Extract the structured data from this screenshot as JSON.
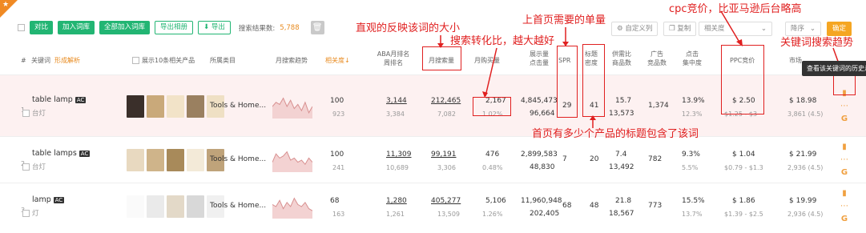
{
  "toolbar": {
    "btn_export_cut": "对比",
    "btn_add_root": "加入词库",
    "btn_add_all": "全部加入词库",
    "btn_export_img": "导出相册",
    "btn_export": "导出",
    "total_label": "搜索结果数:",
    "total_value": "5,788",
    "custom_cols": "自定义列",
    "copy": "复制",
    "sort_field": "相关度",
    "sort_order": "降序",
    "confirm": "确定"
  },
  "headers": {
    "idx": "#",
    "keyword": "关键词",
    "keyword_sub": "形成解析",
    "show_products": "展示10条相关产品",
    "category": "所属类目",
    "trend": "月搜索趋势",
    "relevance": "相关度",
    "aba_rank": "ABA月排名",
    "aba_rank2": "周排名",
    "monthly_search": "月搜索量",
    "monthly_purchase": "月购买量",
    "impressions": "展示量",
    "clicks": "点击量",
    "spr": "SPR",
    "title_density": "标题",
    "title_density2": "密度",
    "supply_demand": "供需比",
    "product_count": "商品数",
    "ad_products": "广告",
    "ad_products2": "竞品数",
    "click_concentration": "点击",
    "click_concentration2": "集中度",
    "ppc": "PPC竞价",
    "market": "市场"
  },
  "rows": [
    {
      "idx": "1",
      "keyword": "table lamp",
      "badge": "AC",
      "cn": "台灯",
      "category": "Tools & Home...",
      "relevance": "100",
      "relevance_sub": "923",
      "aba_rank": "3,144",
      "aba_week": "3,384",
      "monthly_search": "212,465",
      "monthly_search_sub": "7,082",
      "monthly_purchase": "2,167",
      "conversion": "1.02%",
      "impressions": "4,845,473",
      "clicks": "96,664",
      "spr": "29",
      "title_density": "41",
      "supply_demand": "15.7",
      "product_count": "13,573",
      "ad_products": "1,374",
      "click_conc": "13.9%",
      "click_conc_sub": "12.3%",
      "ppc": "$ 2.50",
      "ppc_range": "$1.25 - $3",
      "market": "$ 18.98",
      "market_sub": "3,861 (4.5)",
      "trend": [
        0.5,
        0.7,
        0.6,
        0.9,
        0.5,
        0.8,
        0.4,
        0.6,
        0.3,
        0.7,
        0.2,
        0.5
      ]
    },
    {
      "idx": "2",
      "keyword": "table lamps",
      "badge": "AC",
      "cn": "台灯",
      "category": "Tools & Home...",
      "relevance": "100",
      "relevance_sub": "241",
      "aba_rank": "11,309",
      "aba_week": "10,689",
      "monthly_search": "99,191",
      "monthly_search_sub": "3,306",
      "monthly_purchase": "476",
      "conversion": "0.48%",
      "impressions": "2,899,583",
      "clicks": "48,830",
      "spr": "7",
      "title_density": "20",
      "supply_demand": "7.4",
      "product_count": "13,492",
      "ad_products": "782",
      "click_conc": "9.3%",
      "click_conc_sub": "5.5%",
      "ppc": "$ 1.04",
      "ppc_range": "$0.79 - $1.3",
      "market": "$ 21.99",
      "market_sub": "2,936 (4.5)",
      "trend": [
        0.4,
        0.8,
        0.6,
        0.7,
        0.9,
        0.5,
        0.6,
        0.4,
        0.5,
        0.3,
        0.6,
        0.4
      ]
    },
    {
      "idx": "3",
      "keyword": "lamp",
      "badge": "AC",
      "cn": "灯",
      "category": "Tools & Home...",
      "relevance": "68",
      "relevance_sub": "163",
      "aba_rank": "1,280",
      "aba_week": "1,261",
      "monthly_search": "405,277",
      "monthly_search_sub": "13,509",
      "monthly_purchase": "5,106",
      "conversion": "1.26%",
      "impressions": "11,960,948",
      "clicks": "202,405",
      "spr": "68",
      "title_density": "48",
      "supply_demand": "21.8",
      "product_count": "18,567",
      "ad_products": "773",
      "click_conc": "15.5%",
      "click_conc_sub": "13.7%",
      "ppc": "$ 1.86",
      "ppc_range": "$1.39 - $2.5",
      "market": "$ 19.99",
      "market_sub": "2,936 (4.5)",
      "trend": [
        0.6,
        0.5,
        0.8,
        0.4,
        0.7,
        0.5,
        0.9,
        0.6,
        0.5,
        0.7,
        0.4,
        0.3
      ]
    }
  ],
  "annotations": {
    "size": "直观的反映该词的大小",
    "conversion": "搜索转化比，越大越好",
    "first_page": "上首页需要的单量",
    "cpc": "cpc竞价，比亚马逊后台略高",
    "trend": "关键词搜索趋势",
    "density": "首页有多少个产品的标题包含了该词"
  },
  "tooltip": "查看该关键词的历史走"
}
